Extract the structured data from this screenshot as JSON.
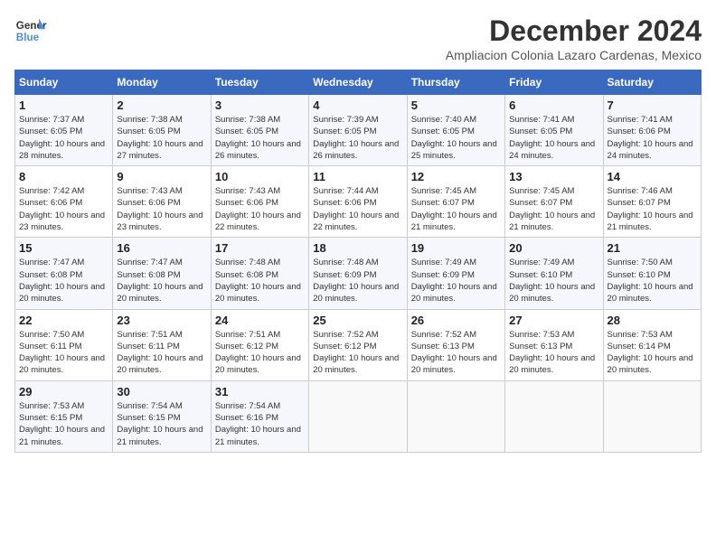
{
  "header": {
    "logo_line1": "General",
    "logo_line2": "Blue",
    "month": "December 2024",
    "location": "Ampliacion Colonia Lazaro Cardenas, Mexico"
  },
  "weekdays": [
    "Sunday",
    "Monday",
    "Tuesday",
    "Wednesday",
    "Thursday",
    "Friday",
    "Saturday"
  ],
  "weeks": [
    [
      {
        "day": "1",
        "sunrise": "7:37 AM",
        "sunset": "6:05 PM",
        "daylight": "10 hours and 28 minutes."
      },
      {
        "day": "2",
        "sunrise": "7:38 AM",
        "sunset": "6:05 PM",
        "daylight": "10 hours and 27 minutes."
      },
      {
        "day": "3",
        "sunrise": "7:38 AM",
        "sunset": "6:05 PM",
        "daylight": "10 hours and 26 minutes."
      },
      {
        "day": "4",
        "sunrise": "7:39 AM",
        "sunset": "6:05 PM",
        "daylight": "10 hours and 26 minutes."
      },
      {
        "day": "5",
        "sunrise": "7:40 AM",
        "sunset": "6:05 PM",
        "daylight": "10 hours and 25 minutes."
      },
      {
        "day": "6",
        "sunrise": "7:41 AM",
        "sunset": "6:05 PM",
        "daylight": "10 hours and 24 minutes."
      },
      {
        "day": "7",
        "sunrise": "7:41 AM",
        "sunset": "6:06 PM",
        "daylight": "10 hours and 24 minutes."
      }
    ],
    [
      {
        "day": "8",
        "sunrise": "7:42 AM",
        "sunset": "6:06 PM",
        "daylight": "10 hours and 23 minutes."
      },
      {
        "day": "9",
        "sunrise": "7:43 AM",
        "sunset": "6:06 PM",
        "daylight": "10 hours and 23 minutes."
      },
      {
        "day": "10",
        "sunrise": "7:43 AM",
        "sunset": "6:06 PM",
        "daylight": "10 hours and 22 minutes."
      },
      {
        "day": "11",
        "sunrise": "7:44 AM",
        "sunset": "6:06 PM",
        "daylight": "10 hours and 22 minutes."
      },
      {
        "day": "12",
        "sunrise": "7:45 AM",
        "sunset": "6:07 PM",
        "daylight": "10 hours and 21 minutes."
      },
      {
        "day": "13",
        "sunrise": "7:45 AM",
        "sunset": "6:07 PM",
        "daylight": "10 hours and 21 minutes."
      },
      {
        "day": "14",
        "sunrise": "7:46 AM",
        "sunset": "6:07 PM",
        "daylight": "10 hours and 21 minutes."
      }
    ],
    [
      {
        "day": "15",
        "sunrise": "7:47 AM",
        "sunset": "6:08 PM",
        "daylight": "10 hours and 20 minutes."
      },
      {
        "day": "16",
        "sunrise": "7:47 AM",
        "sunset": "6:08 PM",
        "daylight": "10 hours and 20 minutes."
      },
      {
        "day": "17",
        "sunrise": "7:48 AM",
        "sunset": "6:08 PM",
        "daylight": "10 hours and 20 minutes."
      },
      {
        "day": "18",
        "sunrise": "7:48 AM",
        "sunset": "6:09 PM",
        "daylight": "10 hours and 20 minutes."
      },
      {
        "day": "19",
        "sunrise": "7:49 AM",
        "sunset": "6:09 PM",
        "daylight": "10 hours and 20 minutes."
      },
      {
        "day": "20",
        "sunrise": "7:49 AM",
        "sunset": "6:10 PM",
        "daylight": "10 hours and 20 minutes."
      },
      {
        "day": "21",
        "sunrise": "7:50 AM",
        "sunset": "6:10 PM",
        "daylight": "10 hours and 20 minutes."
      }
    ],
    [
      {
        "day": "22",
        "sunrise": "7:50 AM",
        "sunset": "6:11 PM",
        "daylight": "10 hours and 20 minutes."
      },
      {
        "day": "23",
        "sunrise": "7:51 AM",
        "sunset": "6:11 PM",
        "daylight": "10 hours and 20 minutes."
      },
      {
        "day": "24",
        "sunrise": "7:51 AM",
        "sunset": "6:12 PM",
        "daylight": "10 hours and 20 minutes."
      },
      {
        "day": "25",
        "sunrise": "7:52 AM",
        "sunset": "6:12 PM",
        "daylight": "10 hours and 20 minutes."
      },
      {
        "day": "26",
        "sunrise": "7:52 AM",
        "sunset": "6:13 PM",
        "daylight": "10 hours and 20 minutes."
      },
      {
        "day": "27",
        "sunrise": "7:53 AM",
        "sunset": "6:13 PM",
        "daylight": "10 hours and 20 minutes."
      },
      {
        "day": "28",
        "sunrise": "7:53 AM",
        "sunset": "6:14 PM",
        "daylight": "10 hours and 20 minutes."
      }
    ],
    [
      {
        "day": "29",
        "sunrise": "7:53 AM",
        "sunset": "6:15 PM",
        "daylight": "10 hours and 21 minutes."
      },
      {
        "day": "30",
        "sunrise": "7:54 AM",
        "sunset": "6:15 PM",
        "daylight": "10 hours and 21 minutes."
      },
      {
        "day": "31",
        "sunrise": "7:54 AM",
        "sunset": "6:16 PM",
        "daylight": "10 hours and 21 minutes."
      },
      null,
      null,
      null,
      null
    ]
  ]
}
